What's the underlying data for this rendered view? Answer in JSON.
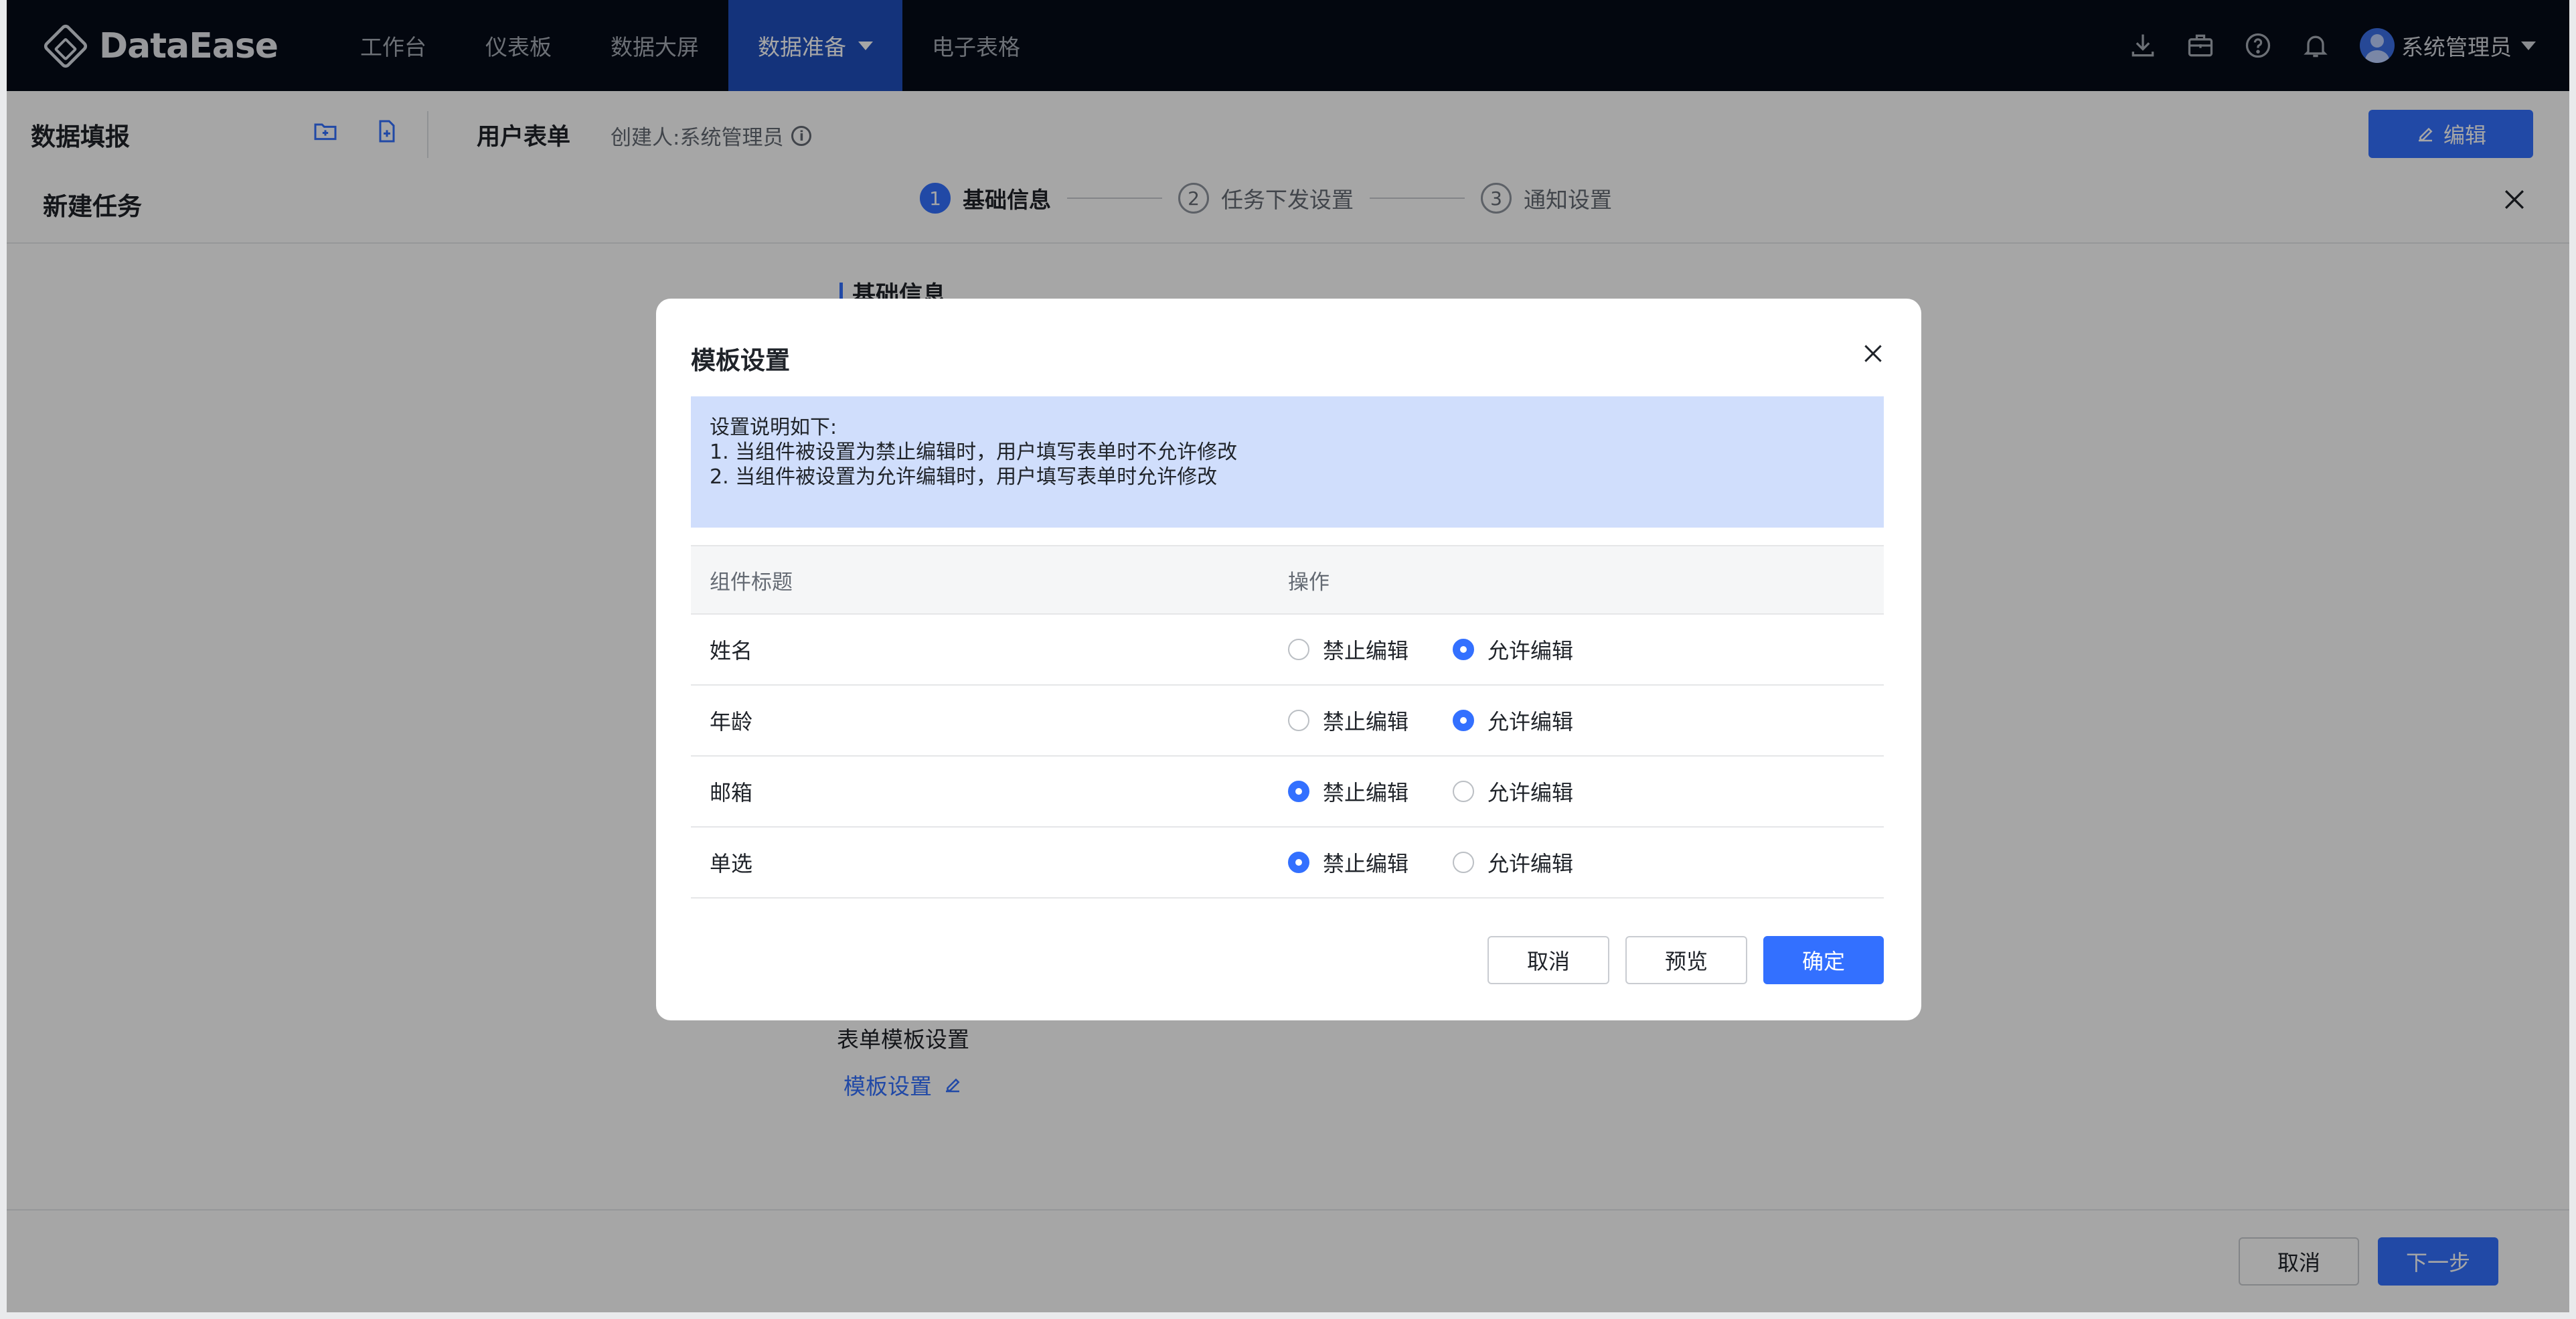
{
  "topbar": {
    "logo_text": "DataEase",
    "nav": [
      {
        "label": "工作台"
      },
      {
        "label": "仪表板"
      },
      {
        "label": "数据大屏"
      },
      {
        "label": "数据准备"
      },
      {
        "label": "电子表格"
      }
    ],
    "active_nav": "数据准备",
    "icons": [
      "download-icon",
      "briefcase-icon",
      "help-icon",
      "bell-icon"
    ],
    "user_name": "系统管理员"
  },
  "subbar": {
    "title": "数据填报",
    "form_name": "用户表单",
    "creator": "创建人:系统管理员",
    "edit_label": "编辑"
  },
  "drawer": {
    "title": "新建任务",
    "steps": [
      {
        "num": "1",
        "label": "基础信息",
        "active": true
      },
      {
        "num": "2",
        "label": "任务下发设置",
        "active": false
      },
      {
        "num": "3",
        "label": "通知设置",
        "active": false
      }
    ],
    "section_label": "基础信息",
    "template_label": "表单模板设置",
    "template_link": "模板设置",
    "cancel_label": "取消",
    "next_label": "下一步"
  },
  "modal": {
    "title": "模板设置",
    "notice": [
      "设置说明如下:",
      "1. 当组件被设置为禁止编辑时，用户填写表单时不允许修改",
      "2. 当组件被设置为允许编辑时，用户填写表单时允许修改"
    ],
    "columns": [
      "组件标题",
      "操作"
    ],
    "options": [
      "禁止编辑",
      "允许编辑"
    ],
    "rows": [
      {
        "title": "姓名",
        "selected": "允许编辑"
      },
      {
        "title": "年龄",
        "selected": "允许编辑"
      },
      {
        "title": "邮箱",
        "selected": "禁止编辑"
      },
      {
        "title": "单选",
        "selected": "禁止编辑"
      }
    ],
    "cancel_label": "取消",
    "preview_label": "预览",
    "confirm_label": "确定"
  },
  "colors": {
    "accent": "#3370ff",
    "topbar_bg": "#050b17",
    "active_nav_bg": "#1f4fbd",
    "notice_bg": "#d0defc"
  }
}
